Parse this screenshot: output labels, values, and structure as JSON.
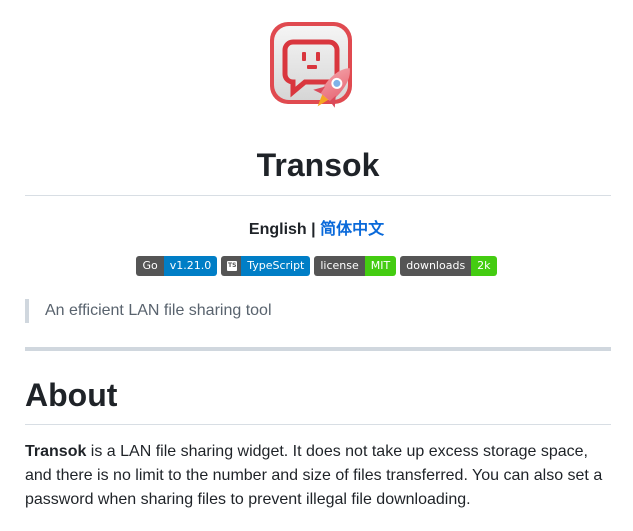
{
  "header": {
    "title": "Transok",
    "languages": {
      "current": "English",
      "separator": " | ",
      "alternate": "简体中文"
    }
  },
  "badges": [
    {
      "label": "Go",
      "value": "v1.21.0",
      "color": "#007ec6"
    },
    {
      "label": "TypeScript",
      "value": "",
      "color": "#007ec6",
      "icon": "typescript-icon"
    },
    {
      "label": "license",
      "value": "MIT",
      "color": "#4c1"
    },
    {
      "label": "downloads",
      "value": "2k",
      "color": "#4c1"
    }
  ],
  "tagline": "An efficient LAN file sharing tool",
  "about": {
    "heading": "About",
    "name": "Transok",
    "description": " is a LAN file sharing widget. It does not take up excess storage space, and there is no limit to the number and size of files transferred. You can also set a password when sharing files to prevent illegal file downloading."
  },
  "colors": {
    "link": "#0969da",
    "logo_red": "#d9363e",
    "badge_blue": "#007ec6",
    "badge_green": "#4c1"
  }
}
